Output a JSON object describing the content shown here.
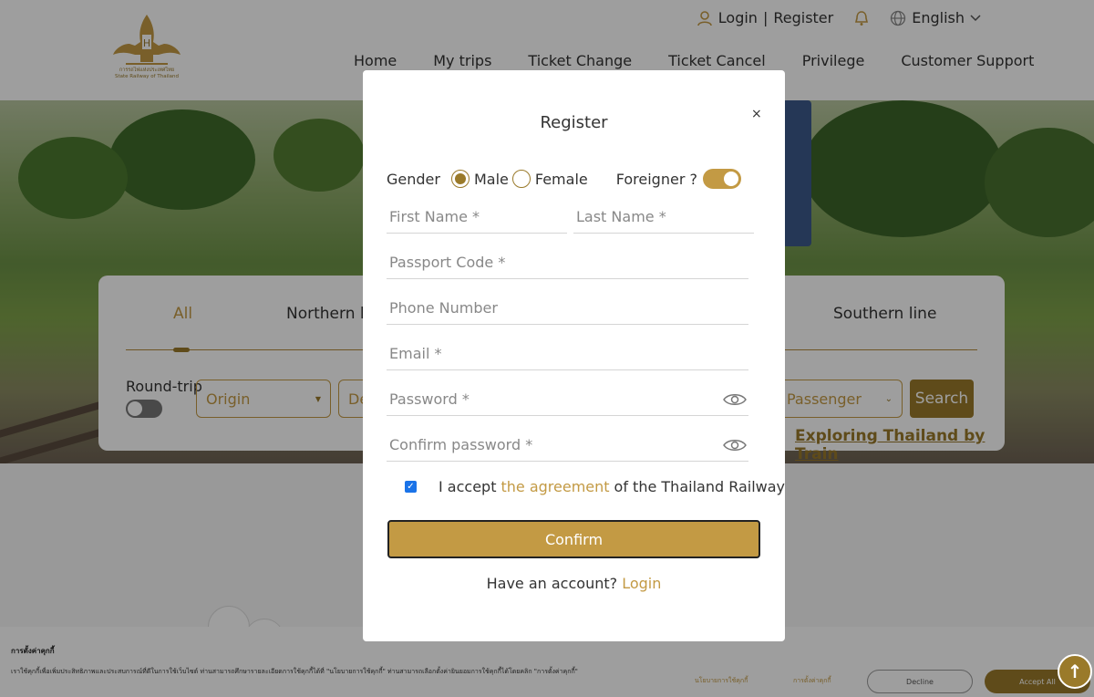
{
  "header": {
    "logo_text_thai": "การรถไฟแห่งประเทศไทย",
    "logo_text_en": "State Railway of Thailand",
    "login_label": "Login",
    "register_label": "Register",
    "language": "English",
    "nav": [
      "Home",
      "My trips",
      "Ticket Change",
      "Ticket Cancel",
      "Privilege",
      "Customer Support"
    ]
  },
  "search_card": {
    "tabs": [
      "All",
      "Northern li",
      "Southern line"
    ],
    "active_tab": "All",
    "round_trip_label": "Round-trip",
    "origin_placeholder": "Origin",
    "destination_placeholder": "De",
    "passenger_placeholder": "Passenger",
    "search_label": "Search",
    "explore_link": "Exploring Thailand by Train"
  },
  "cookie_bar": {
    "title": "การตั้งค่าคุกกี้",
    "text": "เราใช้คุกกี้เพื่อเพิ่มประสิทธิภาพและประสบการณ์ที่ดีในการใช้เว็บไซต์ ท่านสามารถศึกษารายละเอียดการใช้คุกกี้ได้ที่ \"นโยบายการใช้คุกกี้\" ท่านสามารถเลือกตั้งค่ายินยอมการใช้คุกกี้ได้โดยคลิก \"การตั้งค่าคุกกี้\"",
    "policy_link": "นโยบายการใช้คุกกี้",
    "settings_link": "การตั้งค่าคุกกี้",
    "decline": "Decline",
    "accept": "Accept All"
  },
  "modal": {
    "title": "Register",
    "close": "×",
    "gender_label": "Gender",
    "male_label": "Male",
    "female_label": "Female",
    "selected_gender": "Male",
    "foreigner_label": "Foreigner ?",
    "foreigner_on": true,
    "first_name_placeholder": "First Name *",
    "last_name_placeholder": "Last Name *",
    "passport_placeholder": "Passport Code *",
    "phone_placeholder": "Phone Number",
    "email_placeholder": "Email *",
    "password_placeholder": "Password *",
    "confirm_password_placeholder": "Confirm password *",
    "agree_prefix": "I accept",
    "agree_link": "the agreement",
    "agree_suffix": "of the Thailand Railway",
    "agree_checked": true,
    "confirm_label": "Confirm",
    "have_account": "Have an account?",
    "login_link": "Login"
  },
  "colors": {
    "accent": "#c39a44",
    "accent_dark": "#9a7a2a"
  }
}
